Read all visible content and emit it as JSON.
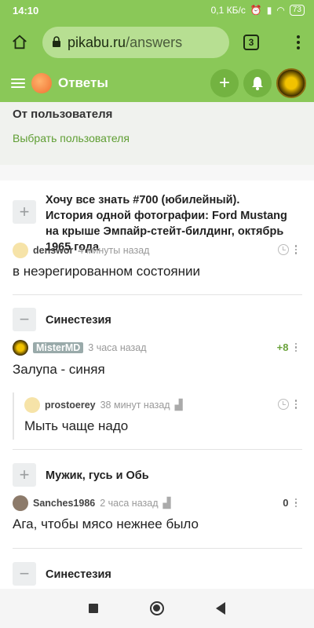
{
  "status": {
    "time": "14:10",
    "speed": "0,1 КБ/с",
    "battery": "73"
  },
  "browser": {
    "url_host": "pikabu.ru",
    "url_path": "/answers",
    "tabs_count": "3"
  },
  "appbar": {
    "title": "Ответы"
  },
  "filter": {
    "title": "От пользователя",
    "link": "Выбрать пользователя"
  },
  "items": [
    {
      "post_title": "Хочу все знать #700 (юбилейный). История одной фотографии: Ford Mustang на крыше Эмпайр-стейт-билдинг, октябрь 1965 года",
      "toggle": "+",
      "author": "denswor",
      "time": "4 минуты назад",
      "text": "в неэрегированном состоянии"
    },
    {
      "post_title": "Синестезия",
      "toggle": "−",
      "author": "MisterMD",
      "time": "3 часа назад",
      "rating": "+8",
      "text": "Залупа - синяя",
      "reply": {
        "author": "prostoerey",
        "time": "38 минут назад",
        "text": "Мыть чаще надо"
      }
    },
    {
      "post_title": "Мужик, гусь и Обь",
      "toggle": "+",
      "author": "Sanches1986",
      "time": "2 часа назад",
      "rating": "0",
      "text": "Ага, чтобы мясо нежнее было"
    },
    {
      "post_title": "Синестезия",
      "toggle": "−"
    }
  ],
  "colors": {
    "brand_green": "#8ac858",
    "link_green": "#5f9e33"
  }
}
